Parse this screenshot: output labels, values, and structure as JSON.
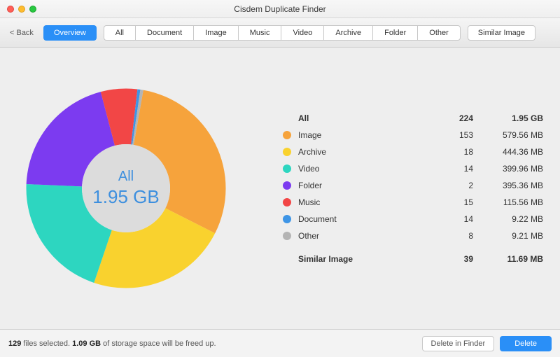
{
  "window": {
    "title": "Cisdem Duplicate Finder"
  },
  "toolbar": {
    "back": "< Back",
    "overview": "Overview",
    "tabs": [
      "All",
      "Document",
      "Image",
      "Music",
      "Video",
      "Archive",
      "Folder",
      "Other"
    ],
    "similar": "Similar Image"
  },
  "chart": {
    "center_label": "All",
    "center_value": "1.95 GB"
  },
  "legend": {
    "all": {
      "name": "All",
      "count": "224",
      "size": "1.95 GB"
    },
    "rows": [
      {
        "color": "#f6a33c",
        "name": "Image",
        "count": "153",
        "size": "579.56 MB"
      },
      {
        "color": "#f9d22e",
        "name": "Archive",
        "count": "18",
        "size": "444.36 MB"
      },
      {
        "color": "#2dd6c0",
        "name": "Video",
        "count": "14",
        "size": "399.96 MB"
      },
      {
        "color": "#7c3bf0",
        "name": "Folder",
        "count": "2",
        "size": "395.36 MB"
      },
      {
        "color": "#f24646",
        "name": "Music",
        "count": "15",
        "size": "115.56 MB"
      },
      {
        "color": "#3e95e6",
        "name": "Document",
        "count": "14",
        "size": "9.22 MB"
      },
      {
        "color": "#b4b4b4",
        "name": "Other",
        "count": "8",
        "size": "9.21 MB"
      }
    ],
    "similar": {
      "name": "Similar Image",
      "count": "39",
      "size": "11.69 MB"
    }
  },
  "footer": {
    "files_selected": "129",
    "mid1": " files selected. ",
    "space_freed": "1.09 GB",
    "mid2": " of storage space will be freed up.",
    "delete_in_finder": "Delete in Finder",
    "delete": "Delete"
  },
  "chart_data": {
    "type": "pie",
    "title": "All 1.95 GB",
    "inner_radius_pct": 40,
    "series": [
      {
        "name": "Image",
        "value_mb": 579.56,
        "color": "#f6a33c"
      },
      {
        "name": "Archive",
        "value_mb": 444.36,
        "color": "#f9d22e"
      },
      {
        "name": "Video",
        "value_mb": 399.96,
        "color": "#2dd6c0"
      },
      {
        "name": "Folder",
        "value_mb": 395.36,
        "color": "#7c3bf0"
      },
      {
        "name": "Music",
        "value_mb": 115.56,
        "color": "#f24646"
      },
      {
        "name": "Document",
        "value_mb": 9.22,
        "color": "#3e95e6"
      },
      {
        "name": "Other",
        "value_mb": 9.21,
        "color": "#b4b4b4"
      }
    ],
    "totals": {
      "count": 224,
      "size_mb": 1953.23,
      "size_label": "1.95 GB"
    }
  }
}
